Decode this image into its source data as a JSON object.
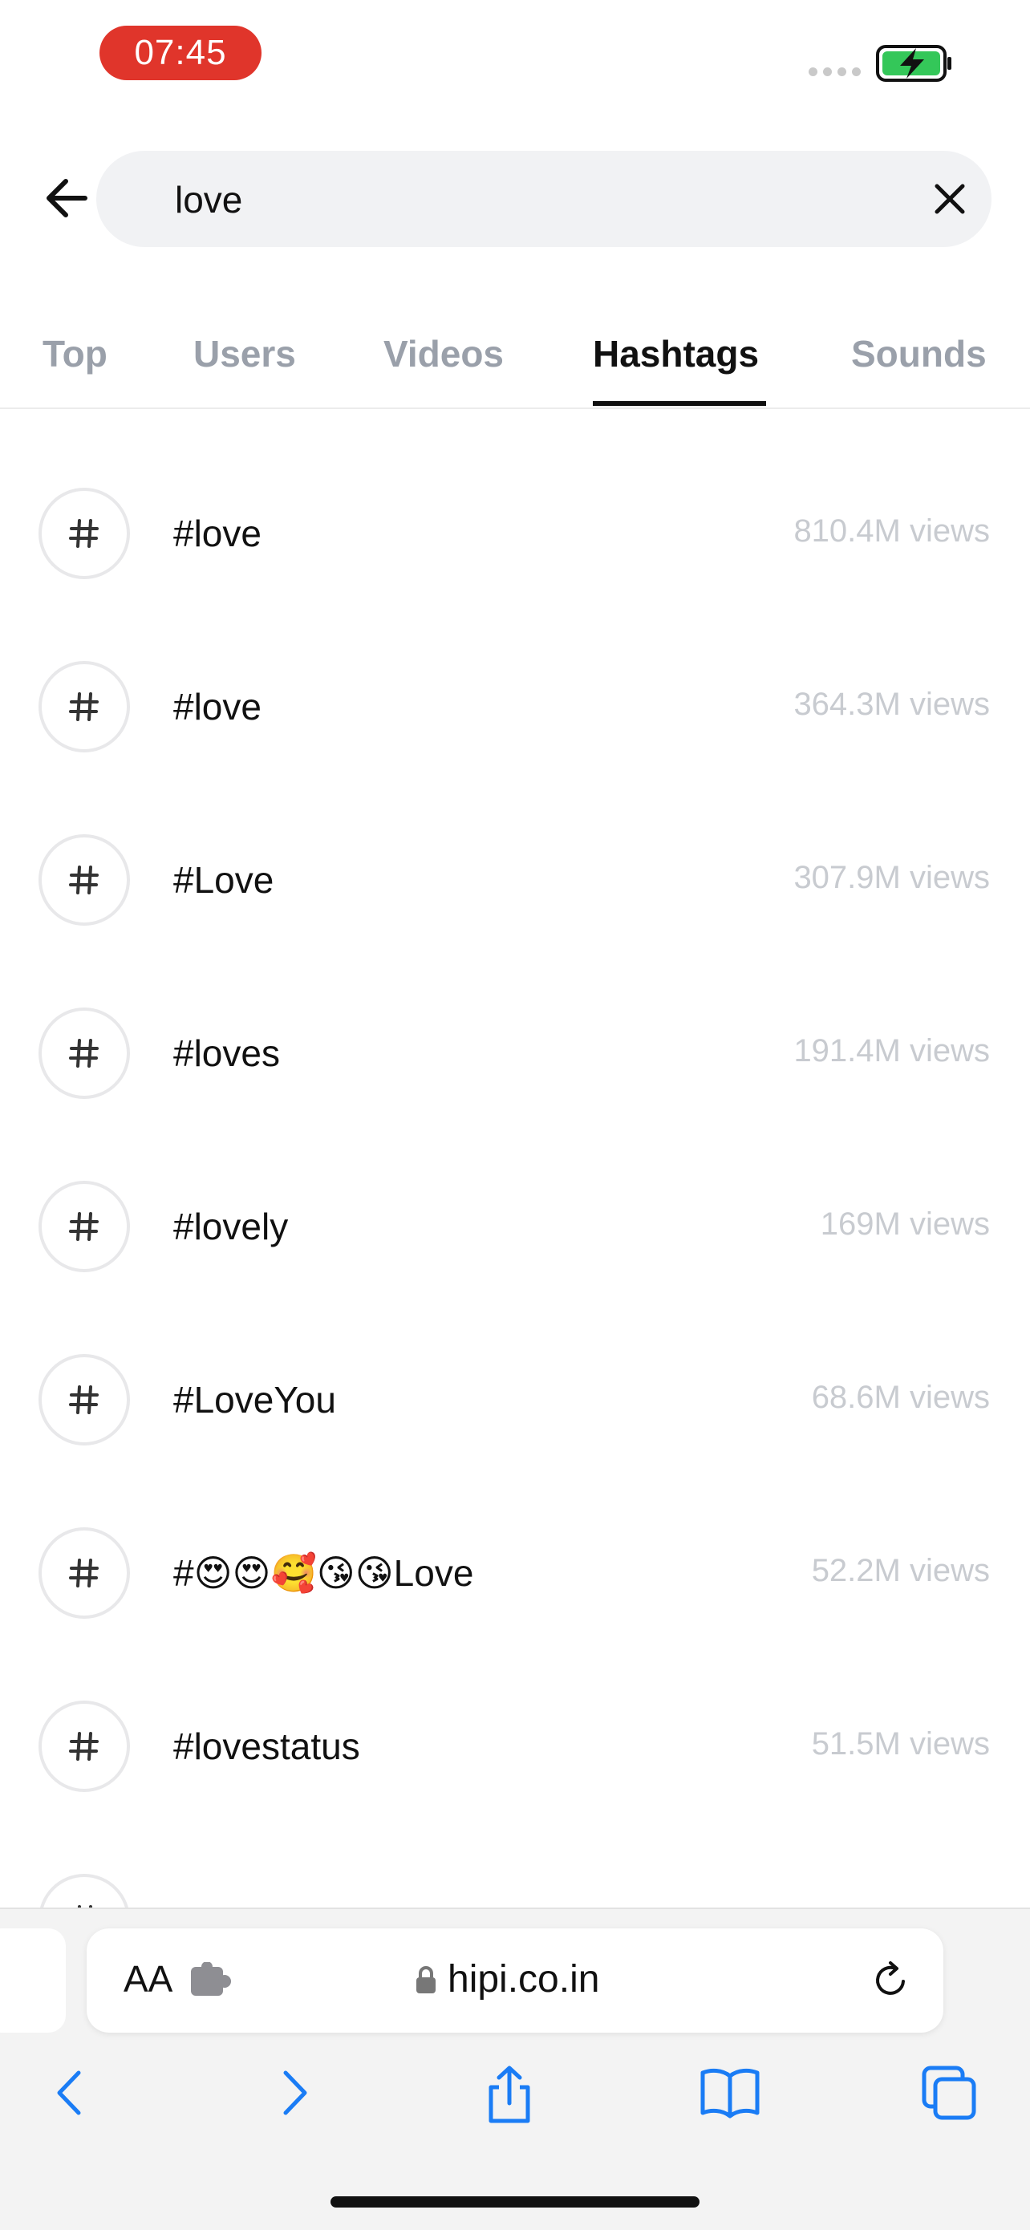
{
  "status_bar": {
    "time": "07:45",
    "time_pill_color": "#e0352b",
    "battery_color": "#34c759",
    "battery_icon": "battery-charging-icon"
  },
  "search": {
    "value": "love",
    "placeholder": "",
    "back_icon": "arrow-left-icon",
    "clear_icon": "close-icon"
  },
  "tabs": [
    {
      "label": "Top",
      "active": false
    },
    {
      "label": "Users",
      "active": false
    },
    {
      "label": "Videos",
      "active": false
    },
    {
      "label": "Hashtags",
      "active": true
    },
    {
      "label": "Sounds",
      "active": false
    }
  ],
  "hashtags": [
    {
      "name": "#love",
      "views": "810.4M views"
    },
    {
      "name": "#love",
      "views": "364.3M views"
    },
    {
      "name": "#Love",
      "views": "307.9M views"
    },
    {
      "name": "#loves",
      "views": "191.4M views"
    },
    {
      "name": "#lovely",
      "views": "169M views"
    },
    {
      "name": "#LoveYou",
      "views": "68.6M views"
    },
    {
      "name": "#😍😍🥰😘😘Love",
      "views": "52.2M views"
    },
    {
      "name": "#lovestatus",
      "views": "51.5M views"
    }
  ],
  "safari": {
    "text_size_label": "AA",
    "url": "hipi.co.in",
    "toolbar_icons": [
      "back-chevron-icon",
      "forward-chevron-icon",
      "share-icon",
      "bookmarks-icon",
      "tabs-icon"
    ],
    "accent": "#1a7cf5"
  }
}
